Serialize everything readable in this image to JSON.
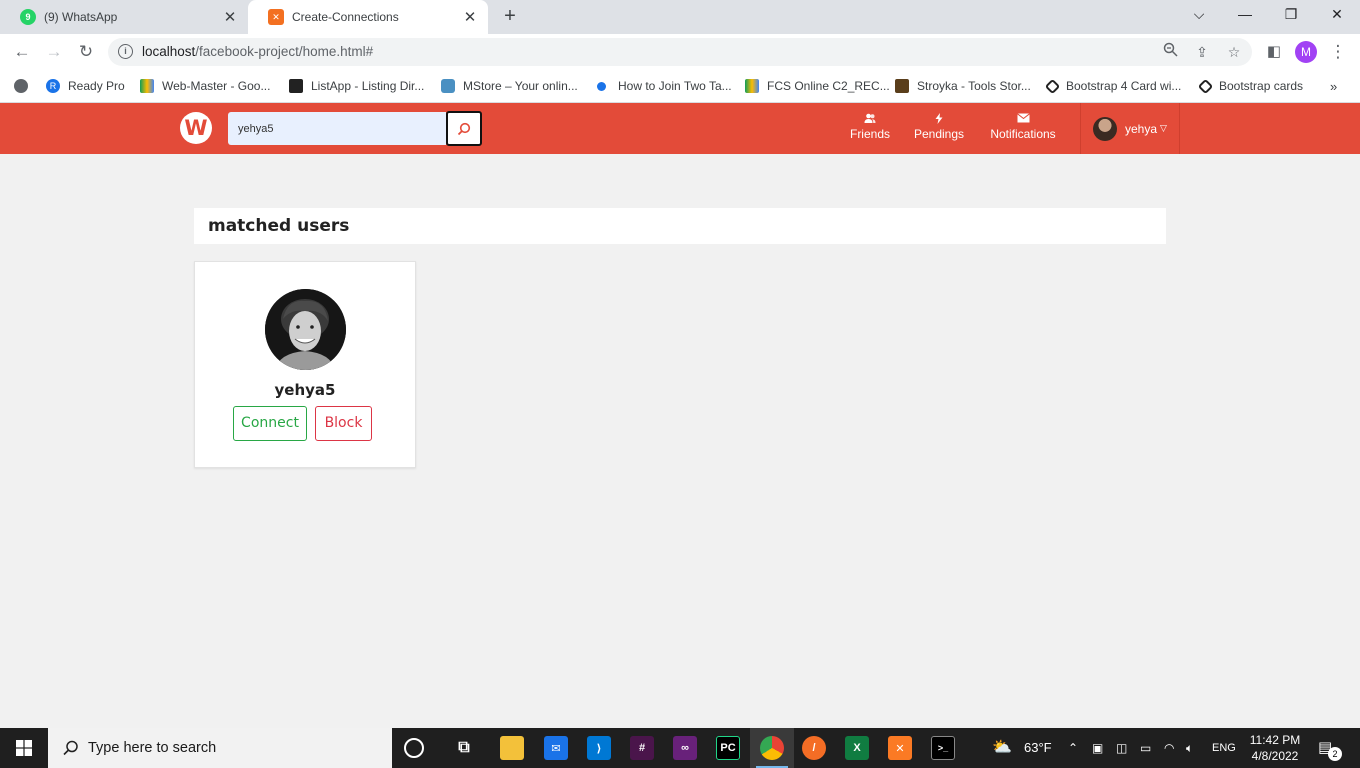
{
  "browser": {
    "tabs": [
      {
        "title": "(9) WhatsApp",
        "favicon_badge": "9"
      },
      {
        "title": "Create-Connections"
      }
    ],
    "url_host": "localhost",
    "url_path": "/facebook-project/home.html#",
    "profile_initial": "M",
    "bookmarks": [
      {
        "label": "Ready Pro",
        "icon": "R"
      },
      {
        "label": "Web-Master - Goo...",
        "icon": ""
      },
      {
        "label": "ListApp - Listing Dir...",
        "icon": ""
      },
      {
        "label": "MStore – Your onlin...",
        "icon": ""
      },
      {
        "label": "How to Join Two Ta...",
        "icon": ""
      },
      {
        "label": "FCS Online C2_REC...",
        "icon": ""
      },
      {
        "label": "Stroyka - Tools Stor...",
        "icon": ""
      },
      {
        "label": "Bootstrap 4 Card wi...",
        "icon": ""
      },
      {
        "label": "Bootstrap cards",
        "icon": ""
      }
    ]
  },
  "site": {
    "logo_letter": "W",
    "search_value": "yehya5",
    "nav": {
      "friends": "Friends",
      "pendings": "Pendings",
      "notifications": "Notifications"
    },
    "user_name": "yehya"
  },
  "results": {
    "heading": "matched users",
    "users": [
      {
        "name": "yehya5",
        "connect_label": "Connect",
        "block_label": "Block"
      }
    ]
  },
  "taskbar": {
    "search_placeholder": "Type here to search",
    "weather": "63°F",
    "language": "ENG",
    "time": "11:42 PM",
    "date": "4/8/2022",
    "notification_count": "2"
  },
  "colors": {
    "brand": "#e34b39",
    "connect": "#28a745",
    "block": "#dc3545"
  }
}
